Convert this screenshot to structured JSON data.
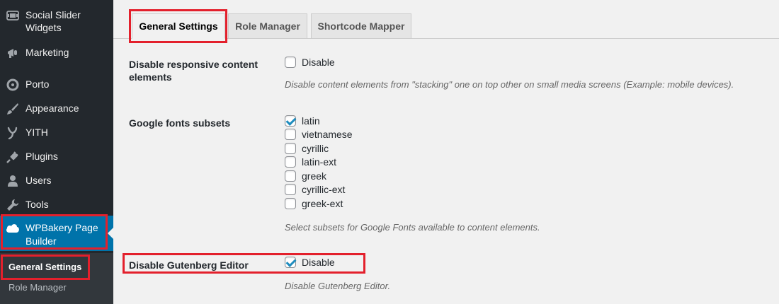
{
  "sidebar": {
    "items": [
      {
        "label": "Social Slider Widgets",
        "icon": "social-slider-icon"
      },
      {
        "label": "Marketing",
        "icon": "megaphone-icon"
      },
      {
        "label": "Porto",
        "icon": "porto-icon"
      },
      {
        "label": "Appearance",
        "icon": "paintbrush-icon"
      },
      {
        "label": "YITH",
        "icon": "yith-icon"
      },
      {
        "label": "Plugins",
        "icon": "plug-icon"
      },
      {
        "label": "Users",
        "icon": "users-icon"
      },
      {
        "label": "Tools",
        "icon": "wrench-icon"
      },
      {
        "label": "WPBakery Page Builder",
        "icon": "cloud-icon"
      }
    ],
    "submenu": [
      {
        "label": "General Settings"
      },
      {
        "label": "Role Manager"
      }
    ]
  },
  "tabs": [
    {
      "label": "General Settings"
    },
    {
      "label": "Role Manager"
    },
    {
      "label": "Shortcode Mapper"
    }
  ],
  "settings": {
    "responsive": {
      "label": "Disable responsive content elements",
      "option": "Disable",
      "checked": false,
      "description": "Disable content elements from \"stacking\" one on top other on small media screens (Example: mobile devices)."
    },
    "fonts": {
      "label": "Google fonts subsets",
      "options": [
        {
          "label": "latin",
          "checked": true
        },
        {
          "label": "vietnamese",
          "checked": false
        },
        {
          "label": "cyrillic",
          "checked": false
        },
        {
          "label": "latin-ext",
          "checked": false
        },
        {
          "label": "greek",
          "checked": false
        },
        {
          "label": "cyrillic-ext",
          "checked": false
        },
        {
          "label": "greek-ext",
          "checked": false
        }
      ],
      "description": "Select subsets for Google Fonts available to content elements."
    },
    "gutenberg": {
      "label": "Disable Gutenberg Editor",
      "option": "Disable",
      "checked": true,
      "description": "Disable Gutenberg Editor."
    }
  },
  "colors": {
    "sidebar_bg": "#23282d",
    "accent": "#0073aa",
    "highlight": "#e3202c"
  }
}
